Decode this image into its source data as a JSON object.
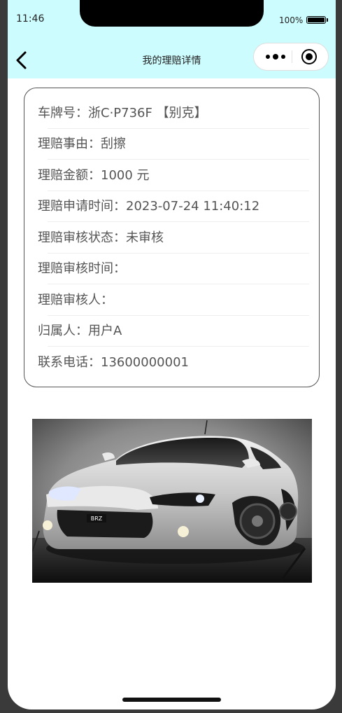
{
  "status_bar": {
    "time": "11:46",
    "battery": "100%"
  },
  "nav": {
    "title": "我的理赔详情"
  },
  "details": [
    {
      "label": "车牌号：",
      "value": "浙C·P736F 【别克】"
    },
    {
      "label": "理赔事由：",
      "value": "刮擦"
    },
    {
      "label": "理赔金额：",
      "value": "1000 元"
    },
    {
      "label": "理赔申请时间：",
      "value": "2023-07-24 11:40:12"
    },
    {
      "label": "理赔审核状态：",
      "value": "未审核"
    },
    {
      "label": "理赔审核时间：",
      "value": ""
    },
    {
      "label": "理赔审核人：",
      "value": ""
    },
    {
      "label": "归属人：",
      "value": "用户A"
    },
    {
      "label": "联系电话：",
      "value": "13600000001"
    }
  ],
  "photo": {
    "plate_text": "BRZ"
  },
  "colors": {
    "header_bg": "#ccfcfd",
    "text": "#555555"
  }
}
